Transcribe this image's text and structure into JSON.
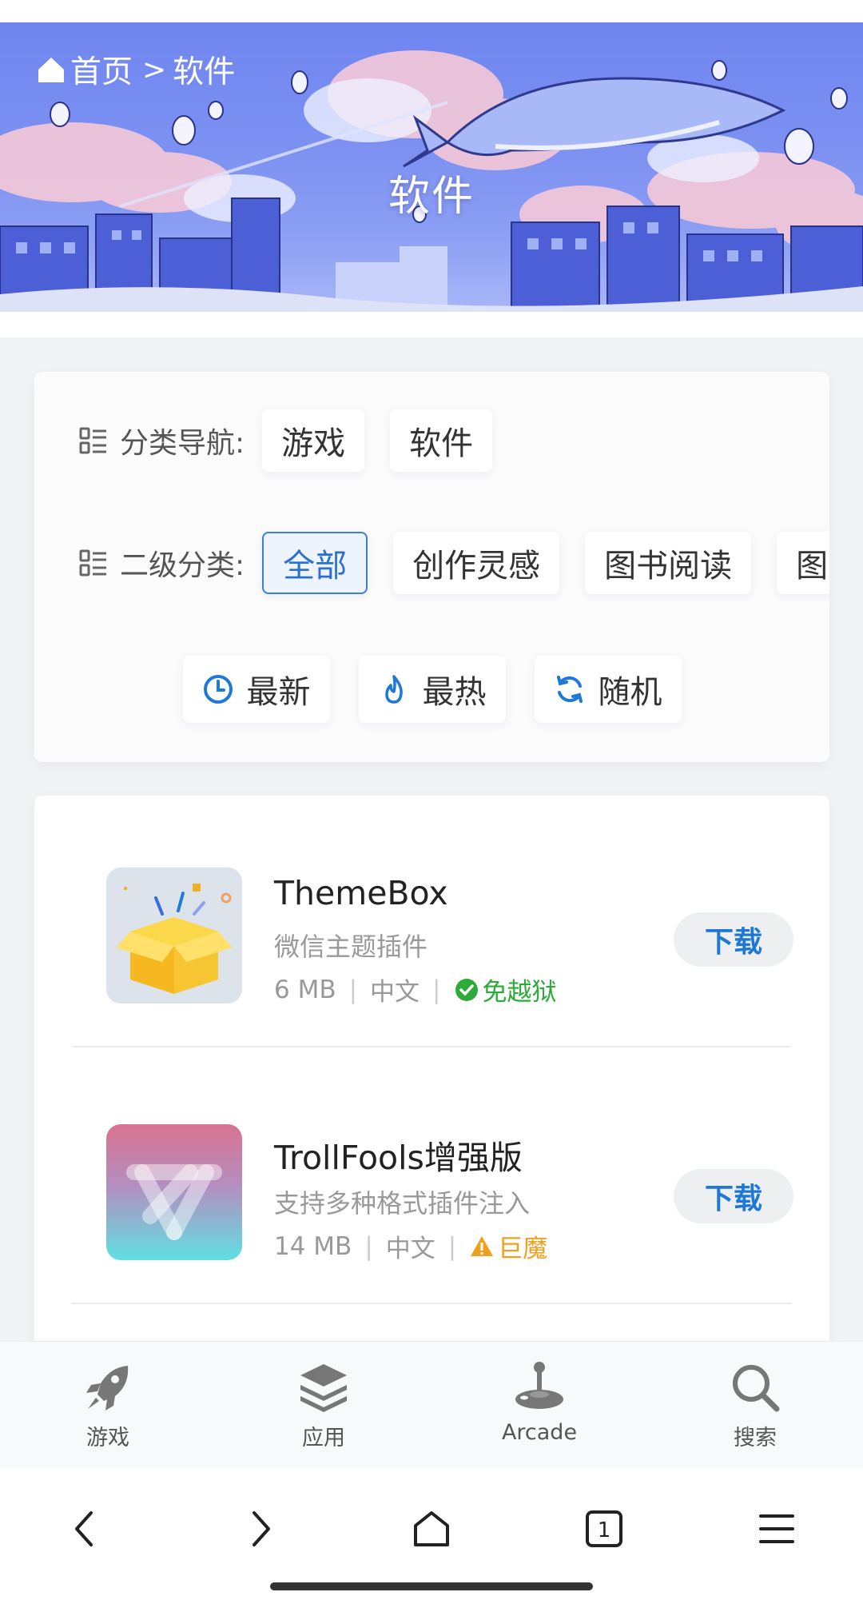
{
  "breadcrumb": {
    "home": "首页",
    "separator": ">",
    "current": "软件"
  },
  "banner": {
    "title": "软件"
  },
  "filters": {
    "category_label": "分类导航:",
    "categories": [
      "游戏",
      "软件"
    ],
    "subcategory_label": "二级分类:",
    "subcategories": [
      "全部",
      "创作灵感",
      "图书阅读",
      "图"
    ],
    "active_subcategory": "全部",
    "sort": {
      "latest": "最新",
      "hottest": "最热",
      "random": "随机"
    }
  },
  "apps": [
    {
      "name": "ThemeBox",
      "desc": "微信主题插件",
      "size": "6 MB",
      "lang": "中文",
      "badge": "免越狱",
      "badge_type": "ok",
      "action": "下载"
    },
    {
      "name": "TrollFools增强版",
      "desc": "支持多种格式插件注入",
      "size": "14 MB",
      "lang": "中文",
      "badge": "巨魔",
      "badge_type": "warn",
      "action": "下载"
    }
  ],
  "tabbar": {
    "games": "游戏",
    "apps": "应用",
    "arcade": "Arcade",
    "search": "搜索"
  },
  "colors": {
    "accent": "#1e78d8",
    "banner": "#6f86f0",
    "ok": "#2eaa3a",
    "warn": "#f0a020"
  },
  "icons": {
    "breadcrumb": "home-icon",
    "filters": [
      "list-icon",
      "clock-icon",
      "flame-icon",
      "refresh-icon"
    ],
    "badges": [
      "check-circle-icon",
      "warning-icon"
    ],
    "tabbar": [
      "rocket-icon",
      "layers-icon",
      "joystick-icon",
      "search-icon"
    ],
    "browser": [
      "back-icon",
      "forward-icon",
      "home-icon",
      "tabs-icon",
      "menu-icon"
    ]
  },
  "browser": {
    "tab_count": "1"
  }
}
